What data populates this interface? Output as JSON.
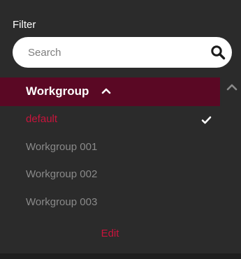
{
  "filter": {
    "label": "Filter",
    "search_placeholder": "Search"
  },
  "workgroup": {
    "header_label": "Workgroup",
    "items": [
      {
        "label": "default",
        "selected": true
      },
      {
        "label": "Workgroup 001",
        "selected": false
      },
      {
        "label": "Workgroup 002",
        "selected": false
      },
      {
        "label": "Workgroup 003",
        "selected": false
      }
    ],
    "edit_label": "Edit"
  },
  "colors": {
    "background": "#2b2b2b",
    "header_background": "#5a0824",
    "accent": "#c8143c",
    "muted_text": "#8a8a8a"
  },
  "icons": {
    "search": "search-icon",
    "collapse": "chevron-up-icon",
    "selected": "check-icon"
  }
}
